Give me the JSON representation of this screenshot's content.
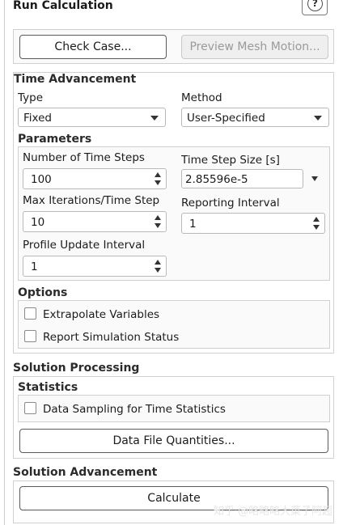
{
  "panel": {
    "title": "Run Calculation",
    "help_glyph": "?",
    "help_icon": "help-icon"
  },
  "top_buttons": {
    "check_case": "Check Case...",
    "preview_mesh_motion": "Preview Mesh Motion..."
  },
  "time_advancement": {
    "title": "Time Advancement",
    "type_label": "Type",
    "type_value": "Fixed",
    "method_label": "Method",
    "method_value": "User-Specified"
  },
  "parameters": {
    "title": "Parameters",
    "num_time_steps_label": "Number of Time Steps",
    "num_time_steps_value": "100",
    "time_step_size_label": "Time Step Size [s]",
    "time_step_size_value": "2.85596e-5",
    "max_iter_label": "Max Iterations/Time Step",
    "max_iter_value": "10",
    "reporting_interval_label": "Reporting Interval",
    "reporting_interval_value": "1",
    "profile_update_label": "Profile Update Interval",
    "profile_update_value": "1"
  },
  "options": {
    "title": "Options",
    "extrapolate_label": "Extrapolate Variables",
    "extrapolate_checked": false,
    "report_status_label": "Report Simulation Status",
    "report_status_checked": false
  },
  "solution_processing": {
    "title": "Solution Processing",
    "statistics_title": "Statistics",
    "data_sampling_label": "Data Sampling for Time Statistics",
    "data_sampling_checked": false,
    "data_file_quantities": "Data File Quantities..."
  },
  "solution_advancement": {
    "title": "Solution Advancement",
    "calculate": "Calculate"
  },
  "watermark": "知乎 @略略略大菜子阿超"
}
